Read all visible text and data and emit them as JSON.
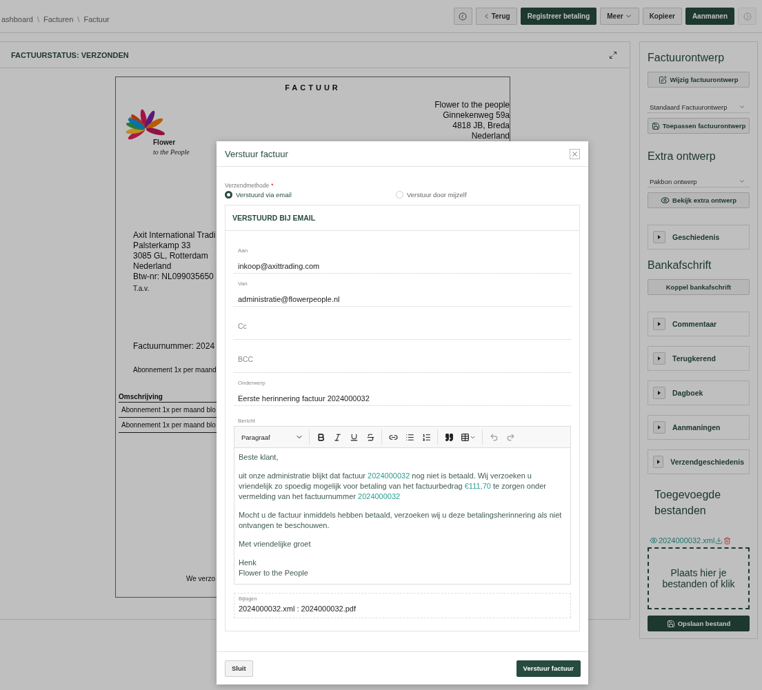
{
  "breadcrumb": [
    {
      "kind": "link",
      "text": "ashboard"
    },
    {
      "kind": "separator",
      "text": "\\"
    },
    {
      "kind": "link",
      "text": "Facturen"
    },
    {
      "kind": "separator",
      "text": "\\"
    },
    {
      "kind": "link",
      "text": "Factuur"
    }
  ],
  "toolbar": [
    {
      "kind": "prev",
      "disabled": false
    },
    {
      "kind": "back",
      "label": "Terug",
      "disabled": false
    },
    {
      "kind": "primary",
      "label": "Registreer betaling",
      "disabled": false
    },
    {
      "kind": "menu",
      "label": "Meer",
      "disabled": false
    },
    {
      "kind": "default",
      "label": "Kopieer",
      "disabled": false
    },
    {
      "kind": "primary",
      "label": "Aanmanen",
      "disabled": false
    },
    {
      "kind": "next",
      "disabled": true
    }
  ],
  "invoice": {
    "status": "FACTUURSTATUS: VERZONDEN",
    "title": "FACTUUR",
    "logo": {
      "line1": "Flower",
      "line2": "to the People"
    },
    "sender": [
      "Flower to the people",
      "Ginnekenweg 59a",
      "4818 JB, Breda",
      "Nederland"
    ],
    "recipient": [
      "Axit International Tradi",
      "Palsterkamp 33",
      "3085 GL, Rotterdam",
      "Nederland",
      "Btw-nr: NL099035650"
    ],
    "attention": "T.a.v.",
    "number": "Factuurnummer: 2024",
    "subscription": "Abonnement 1x per maand",
    "table": {
      "columns": [
        "Omschrijving"
      ],
      "rows": [
        [
          "Abonnement 1x per maand blo"
        ],
        [
          "Abonnement 1x per maand blo"
        ]
      ]
    },
    "footer": "We verzo"
  },
  "sidebar": [
    {
      "kind": "heading",
      "text": "Factuurontwerp"
    },
    {
      "kind": "edit",
      "label": "Wijzig factuurontwerp"
    },
    {
      "kind": "select",
      "value": "Standaard Factuurontwerp"
    },
    {
      "kind": "apply",
      "label": "Toepassen factuurontwerp"
    },
    {
      "kind": "heading",
      "text": "Extra ontwerp"
    },
    {
      "kind": "select",
      "value": "Pakbon ontwerp"
    },
    {
      "kind": "view",
      "label": "Bekijk extra ontwerp"
    },
    {
      "kind": "collapsible",
      "label": "Geschiedenis",
      "expanded": false
    },
    {
      "kind": "heading",
      "text": "Bankafschrift"
    },
    {
      "kind": "plain",
      "label": "Koppel bankafschrift"
    },
    {
      "kind": "collapsible",
      "label": "Commentaar",
      "expanded": false
    },
    {
      "kind": "collapsible",
      "label": "Terugkerend",
      "expanded": false
    },
    {
      "kind": "collapsible",
      "label": "Dagboek",
      "expanded": false
    },
    {
      "kind": "collapsible",
      "label": "Aanmaningen",
      "expanded": false
    },
    {
      "kind": "collapsible",
      "label": "Verzendgeschiedenis",
      "expanded": false
    },
    {
      "kind": "subheading",
      "text": "Toegevoegde bestanden"
    },
    {
      "kind": "file",
      "name": "2024000032.xml"
    },
    {
      "kind": "dropzone",
      "text": "Plaats hier je bestanden of klik"
    },
    {
      "kind": "upload",
      "label": "Opslaan bestand"
    }
  ],
  "modal": {
    "title": "Verstuur factuur",
    "method": {
      "label": "Verzendmethode",
      "required_mark": "*",
      "options": [
        {
          "label": "Verstuurd via email",
          "selected": true
        },
        {
          "label": "Verstuur door mijzelf",
          "selected": false
        }
      ]
    },
    "section": "VERSTUURD BIJ EMAIL",
    "fields": [
      {
        "label": "Aan",
        "value": "inkoop@axittrading.com"
      },
      {
        "label": "Van",
        "value": "administratie@flowerpeople.nl"
      },
      {
        "label": "Cc"
      },
      {
        "label": "BCC"
      },
      {
        "label": "Onderwerp",
        "value": "Eerste herinnering factuur 2024000032"
      }
    ],
    "editor": {
      "label": "Bericht",
      "block_format": "Paragraaf",
      "paragraphs": [
        {
          "lines": [
            [
              {
                "kind": "text",
                "text": "Beste klant,"
              }
            ]
          ]
        },
        {
          "lines": [
            [
              {
                "kind": "text",
                "text": "uit onze administratie blijkt dat factuur "
              },
              {
                "kind": "link",
                "text": "2024000032"
              },
              {
                "kind": "text",
                "text": " nog niet is betaald. Wij verzoeken u vriendelijk zo spoedig mogelijk voor betaling van het factuurbedrag "
              },
              {
                "kind": "link",
                "text": "€111,70"
              },
              {
                "kind": "text",
                "text": " te zorgen onder vermelding van het factuurnummer "
              },
              {
                "kind": "link",
                "text": "2024000032"
              }
            ]
          ]
        },
        {
          "lines": [
            [
              {
                "kind": "text",
                "text": "Mocht u de factuur inmiddels hebben betaald, verzoeken wij u deze betalingsherinnering als niet ontvangen te beschouwen."
              }
            ]
          ]
        },
        {
          "lines": [
            [
              {
                "kind": "text",
                "text": "Met vriendelijke groet"
              }
            ]
          ]
        },
        {
          "lines": [
            [
              {
                "kind": "text",
                "text": "Henk"
              }
            ],
            [
              {
                "kind": "text",
                "text": "Flower to the People"
              }
            ]
          ]
        }
      ]
    },
    "attachments": {
      "label": "Bijlagen",
      "value": "2024000032.xml : 2024000032.pdf"
    },
    "close_button": "Sluit",
    "submit_button": "Verstuur factuur"
  }
}
